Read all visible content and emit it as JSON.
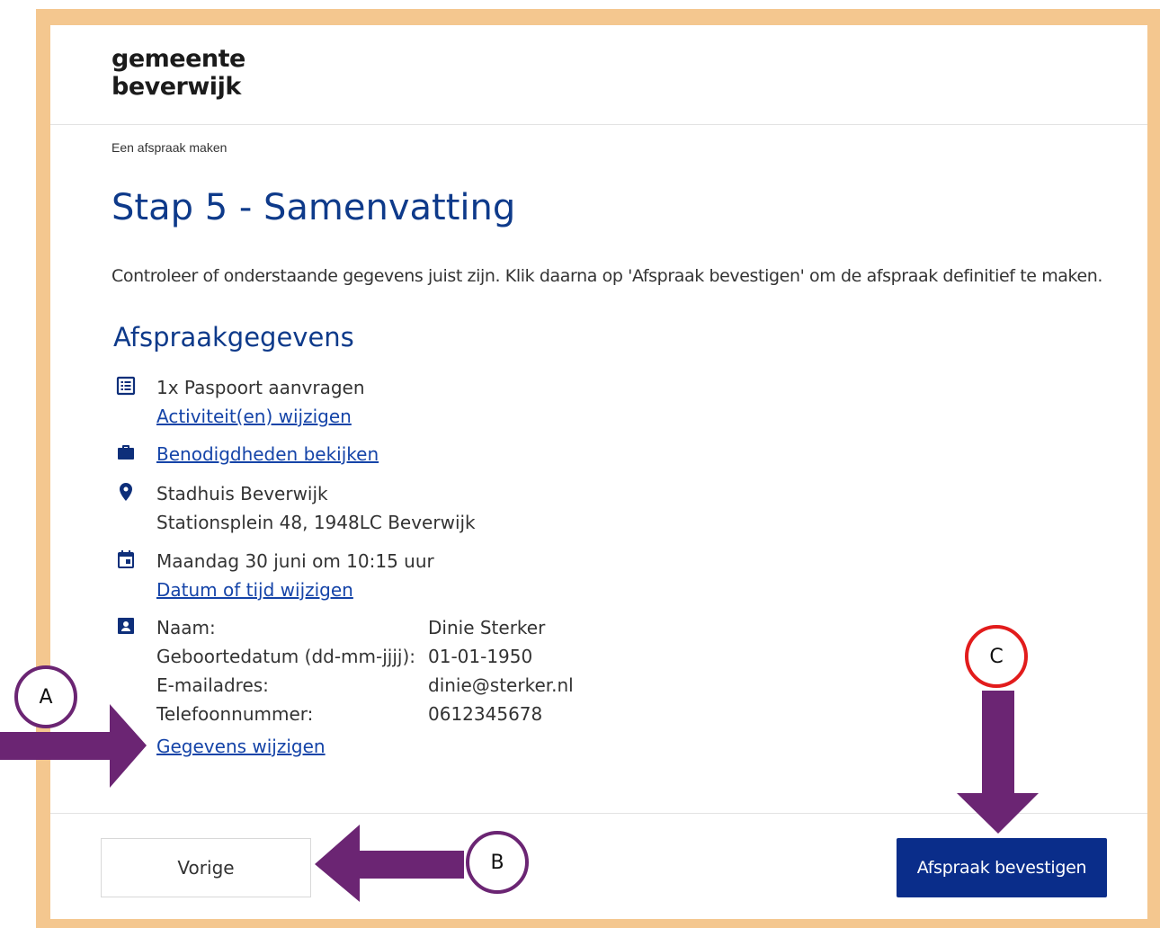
{
  "logo": {
    "line1": "gemeente",
    "line2": "beverwijk"
  },
  "breadcrumb": "Een afspraak maken",
  "page_title": "Stap 5 - Samenvatting",
  "intro": "Controleer of onderstaande gegevens juist zijn. Klik daarna op 'Afspraak bevestigen' om de afspraak definitief te maken.",
  "section_title": "Afspraakgegevens",
  "activity": {
    "text": "1x Paspoort aanvragen",
    "link": "Activiteit(en) wijzigen",
    "icon": "list-icon"
  },
  "requirements": {
    "link": "Benodigdheden bekijken",
    "icon": "briefcase-icon"
  },
  "location": {
    "name": "Stadhuis Beverwijk",
    "address": "Stationsplein 48, 1948LC Beverwijk",
    "icon": "location-pin-icon"
  },
  "datetime": {
    "text": "Maandag 30 juni om 10:15 uur",
    "link": "Datum of tijd wijzigen",
    "icon": "calendar-icon"
  },
  "person": {
    "icon": "contact-card-icon",
    "fields": [
      {
        "label": "Naam:",
        "value": "Dinie Sterker"
      },
      {
        "label": "Geboortedatum (dd-mm-jjjj):",
        "value": "01-01-1950"
      },
      {
        "label": "E-mailadres:",
        "value": "dinie@sterker.nl"
      },
      {
        "label": "Telefoonnummer:",
        "value": "0612345678"
      }
    ],
    "link": "Gegevens wijzigen"
  },
  "buttons": {
    "previous": "Vorige",
    "confirm": "Afspraak bevestigen"
  },
  "annotations": {
    "a": "A",
    "b": "B",
    "c": "C",
    "arrow_color": "#6b2573",
    "circle_c_color": "#e21c1c"
  },
  "colors": {
    "frame": "#f4c78f",
    "primary": "#0a2d8a",
    "link": "#1544a8"
  }
}
